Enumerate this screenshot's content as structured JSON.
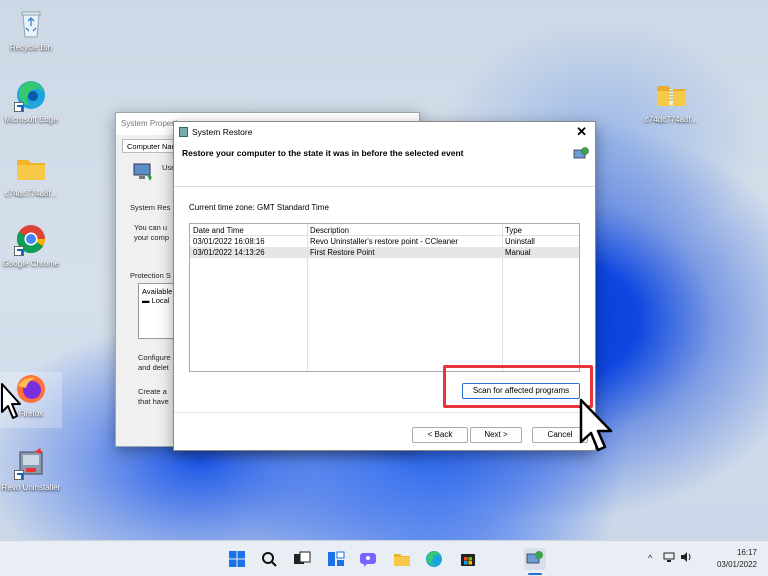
{
  "desktop": {
    "icons": [
      {
        "label": "Recycle Bin",
        "icon": "recycle-bin-icon"
      },
      {
        "label": "Microsoft Edge",
        "icon": "edge-icon"
      },
      {
        "label": "c74dc774a8f...",
        "icon": "folder-icon"
      },
      {
        "label": "Google Chrome",
        "icon": "chrome-icon"
      },
      {
        "label": "Firefox",
        "icon": "firefox-icon"
      },
      {
        "label": "Revo Uninstaller",
        "icon": "revo-uninstaller-icon"
      },
      {
        "label": "c74dc774a8f...",
        "icon": "zip-folder-icon"
      }
    ]
  },
  "system_properties": {
    "title": "System Properties",
    "tab": "Computer Name",
    "use_text": "Use",
    "system_restore_label": "System Res",
    "desc_line1": "You can u",
    "desc_line2": "your comp",
    "protection_label": "Protection S",
    "list_header": "Available",
    "list_item": "Local",
    "configure_line1": "Configure",
    "configure_line2": "and delet",
    "create_line1": "Create a",
    "create_line2": "that have"
  },
  "system_restore": {
    "title": "System Restore",
    "heading": "Restore your computer to the state it was in before the selected event",
    "timezone": "Current time zone: GMT Standard Time",
    "columns": [
      "Date and Time",
      "Description",
      "Type"
    ],
    "rows": [
      {
        "date": "03/01/2022 16:08:16",
        "description": "Revo Uninstaller's restore point - CCleaner",
        "type": "Uninstall"
      },
      {
        "date": "03/01/2022 14:13:26",
        "description": "First Restore Point",
        "type": "Manual"
      }
    ],
    "scan_button": "Scan for affected programs",
    "back_button": "< Back",
    "next_button": "Next >",
    "cancel_button": "Cancel",
    "close_symbol": "✕"
  },
  "taskbar": {
    "icons": [
      "start-icon",
      "search-icon",
      "task-view-icon",
      "widgets-icon",
      "chat-icon",
      "file-explorer-icon",
      "edge-icon",
      "store-icon",
      "system-restore-icon"
    ],
    "time": "16:17",
    "date": "03/01/2022"
  },
  "colors": {
    "highlight": "#e8343a",
    "accent": "#2b6fd1"
  }
}
